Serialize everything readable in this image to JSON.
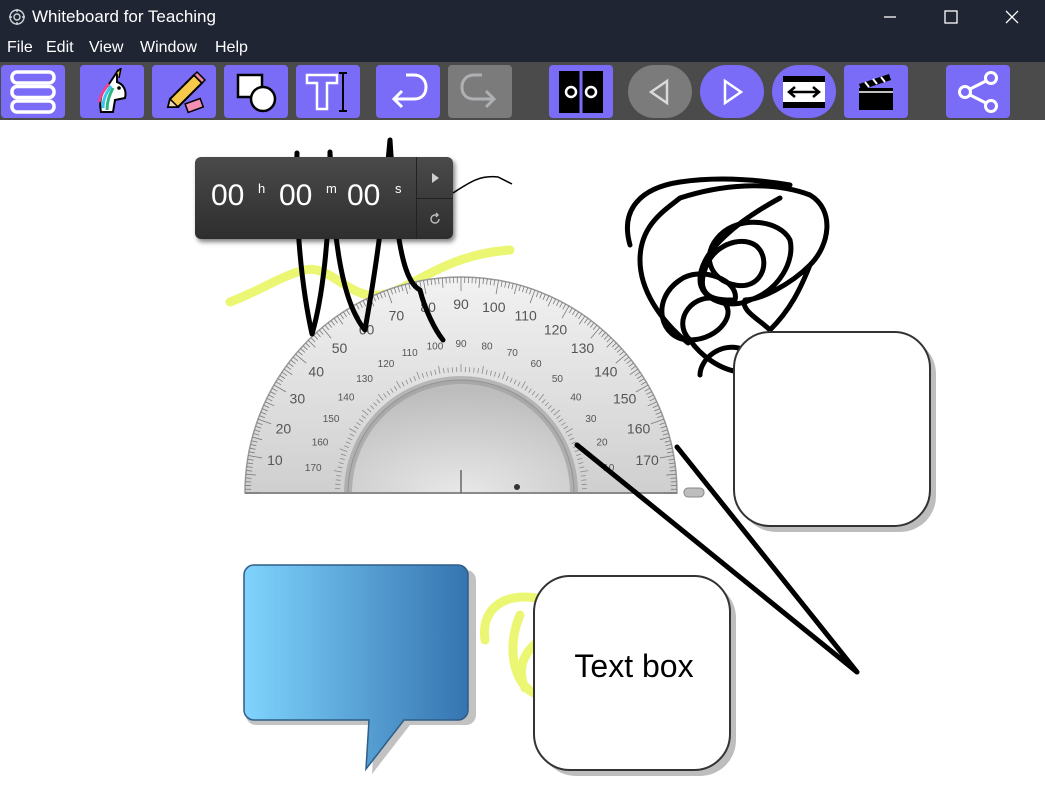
{
  "window": {
    "title": "Whiteboard for Teaching"
  },
  "menu": [
    "File",
    "Edit",
    "View",
    "Window",
    "Help"
  ],
  "toolbar": {
    "buttons": [
      {
        "icon": "menu-stack-icon"
      },
      {
        "icon": "unicorn-icon"
      },
      {
        "icon": "pencil-eraser-icon"
      },
      {
        "icon": "shapes-icon"
      },
      {
        "icon": "text-tool-icon"
      },
      {
        "icon": "undo-icon"
      },
      {
        "icon": "redo-icon",
        "disabled": true
      },
      {
        "icon": "split-view-icon"
      },
      {
        "icon": "previous-icon",
        "disabled": true
      },
      {
        "icon": "next-icon"
      },
      {
        "icon": "fit-width-icon"
      },
      {
        "icon": "clapperboard-icon"
      },
      {
        "icon": "share-icon"
      }
    ]
  },
  "timer": {
    "hours": "00",
    "minutes": "00",
    "seconds": "00",
    "h_unit": "h",
    "m_unit": "m",
    "s_unit": "s"
  },
  "protractor": {
    "outer_labels": [
      "170",
      "160",
      "150",
      "140",
      "130",
      "120",
      "110",
      "100",
      "90",
      "80",
      "70",
      "60",
      "50",
      "40",
      "30",
      "20",
      "10"
    ],
    "inner_labels": [
      "10",
      "20",
      "30",
      "40",
      "50",
      "60",
      "70",
      "80",
      "90",
      "100",
      "110",
      "120",
      "130",
      "140",
      "150",
      "160",
      "170"
    ]
  },
  "canvas": {
    "textbox_text": "Text box"
  },
  "colors": {
    "titlebar": "#1f2533",
    "toolbar": "#4b4b4b",
    "accent": "#7a6cf7",
    "disabled": "#7b7b7b",
    "highlighter": "#eaf56a"
  }
}
